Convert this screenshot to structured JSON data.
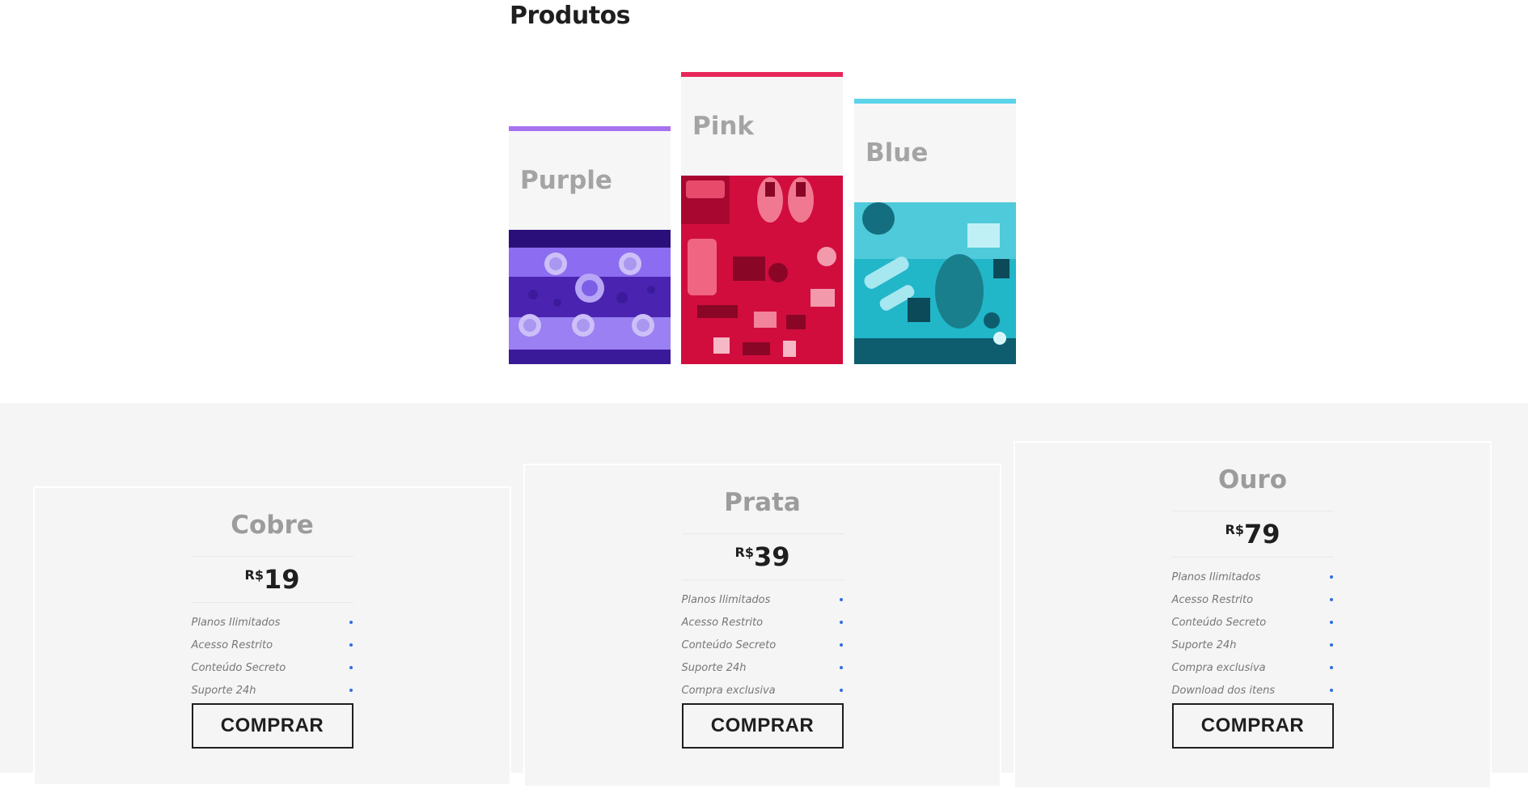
{
  "produtos": {
    "title": "Produtos",
    "cards": [
      {
        "name": "Purple",
        "accent": "#a772f0",
        "tint": "#6b3fe0"
      },
      {
        "name": "Pink",
        "accent": "#e8285a",
        "tint": "#d10d3e"
      },
      {
        "name": "Blue",
        "accent": "#5dd3ea",
        "tint": "#19b9cc"
      }
    ]
  },
  "planos": [
    {
      "name": "Cobre",
      "currency": "R$",
      "price": "19",
      "features": [
        "Planos Ilimitados",
        "Acesso Restrito",
        "Conteúdo Secreto",
        "Suporte 24h"
      ],
      "button": "COMPRAR"
    },
    {
      "name": "Prata",
      "currency": "R$",
      "price": "39",
      "features": [
        "Planos Ilimitados",
        "Acesso Restrito",
        "Conteúdo Secreto",
        "Suporte 24h",
        "Compra exclusiva"
      ],
      "button": "COMPRAR"
    },
    {
      "name": "Ouro",
      "currency": "R$",
      "price": "79",
      "features": [
        "Planos Ilimitados",
        "Acesso Restrito",
        "Conteúdo Secreto",
        "Suporte 24h",
        "Compra exclusiva",
        "Download dos itens"
      ],
      "button": "COMPRAR"
    }
  ],
  "colors": {
    "bullet": "#2f6fe0",
    "section_bg": "#f5f5f5"
  }
}
